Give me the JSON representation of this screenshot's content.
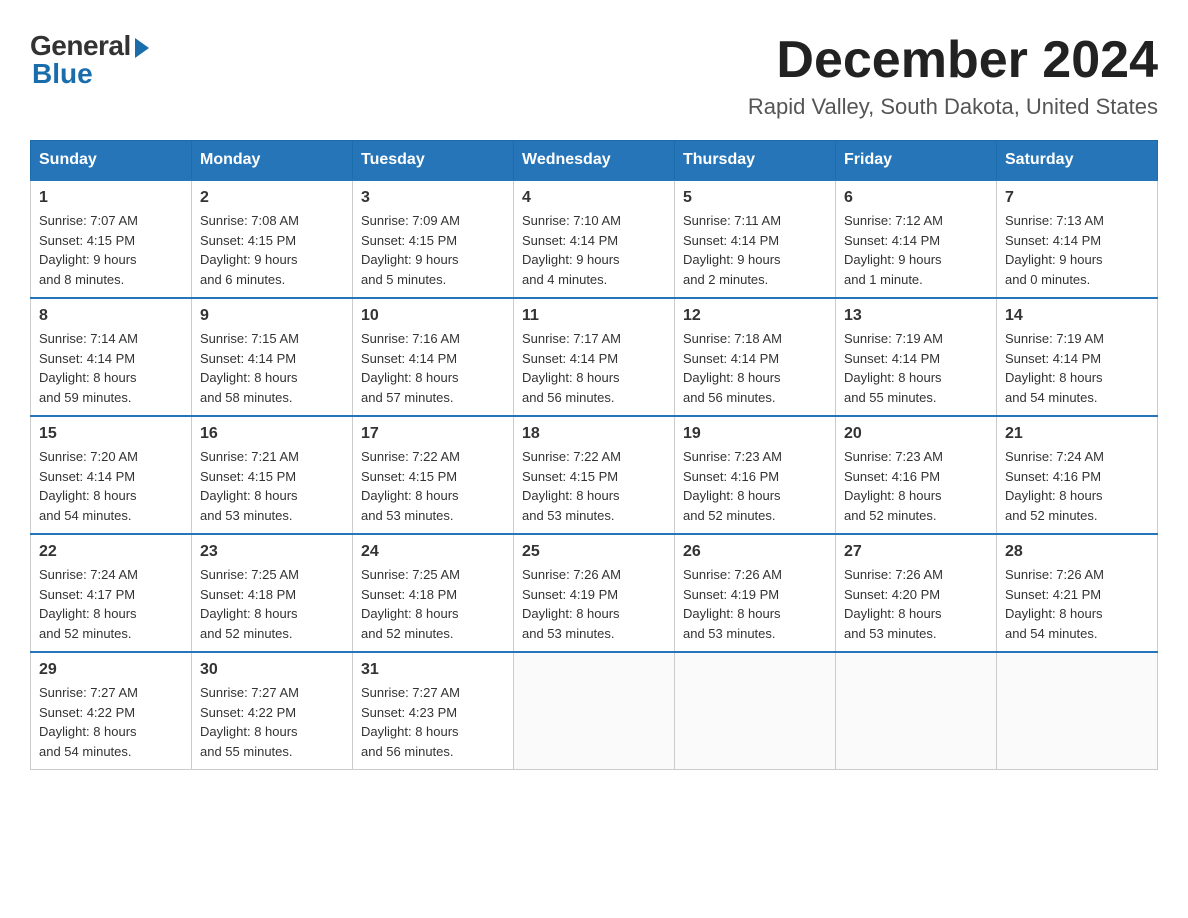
{
  "logo": {
    "general": "General",
    "blue": "Blue"
  },
  "header": {
    "month": "December 2024",
    "location": "Rapid Valley, South Dakota, United States"
  },
  "weekdays": [
    "Sunday",
    "Monday",
    "Tuesday",
    "Wednesday",
    "Thursday",
    "Friday",
    "Saturday"
  ],
  "weeks": [
    [
      {
        "day": "1",
        "sunrise": "7:07 AM",
        "sunset": "4:15 PM",
        "daylight": "9 hours and 8 minutes."
      },
      {
        "day": "2",
        "sunrise": "7:08 AM",
        "sunset": "4:15 PM",
        "daylight": "9 hours and 6 minutes."
      },
      {
        "day": "3",
        "sunrise": "7:09 AM",
        "sunset": "4:15 PM",
        "daylight": "9 hours and 5 minutes."
      },
      {
        "day": "4",
        "sunrise": "7:10 AM",
        "sunset": "4:14 PM",
        "daylight": "9 hours and 4 minutes."
      },
      {
        "day": "5",
        "sunrise": "7:11 AM",
        "sunset": "4:14 PM",
        "daylight": "9 hours and 2 minutes."
      },
      {
        "day": "6",
        "sunrise": "7:12 AM",
        "sunset": "4:14 PM",
        "daylight": "9 hours and 1 minute."
      },
      {
        "day": "7",
        "sunrise": "7:13 AM",
        "sunset": "4:14 PM",
        "daylight": "9 hours and 0 minutes."
      }
    ],
    [
      {
        "day": "8",
        "sunrise": "7:14 AM",
        "sunset": "4:14 PM",
        "daylight": "8 hours and 59 minutes."
      },
      {
        "day": "9",
        "sunrise": "7:15 AM",
        "sunset": "4:14 PM",
        "daylight": "8 hours and 58 minutes."
      },
      {
        "day": "10",
        "sunrise": "7:16 AM",
        "sunset": "4:14 PM",
        "daylight": "8 hours and 57 minutes."
      },
      {
        "day": "11",
        "sunrise": "7:17 AM",
        "sunset": "4:14 PM",
        "daylight": "8 hours and 56 minutes."
      },
      {
        "day": "12",
        "sunrise": "7:18 AM",
        "sunset": "4:14 PM",
        "daylight": "8 hours and 56 minutes."
      },
      {
        "day": "13",
        "sunrise": "7:19 AM",
        "sunset": "4:14 PM",
        "daylight": "8 hours and 55 minutes."
      },
      {
        "day": "14",
        "sunrise": "7:19 AM",
        "sunset": "4:14 PM",
        "daylight": "8 hours and 54 minutes."
      }
    ],
    [
      {
        "day": "15",
        "sunrise": "7:20 AM",
        "sunset": "4:14 PM",
        "daylight": "8 hours and 54 minutes."
      },
      {
        "day": "16",
        "sunrise": "7:21 AM",
        "sunset": "4:15 PM",
        "daylight": "8 hours and 53 minutes."
      },
      {
        "day": "17",
        "sunrise": "7:22 AM",
        "sunset": "4:15 PM",
        "daylight": "8 hours and 53 minutes."
      },
      {
        "day": "18",
        "sunrise": "7:22 AM",
        "sunset": "4:15 PM",
        "daylight": "8 hours and 53 minutes."
      },
      {
        "day": "19",
        "sunrise": "7:23 AM",
        "sunset": "4:16 PM",
        "daylight": "8 hours and 52 minutes."
      },
      {
        "day": "20",
        "sunrise": "7:23 AM",
        "sunset": "4:16 PM",
        "daylight": "8 hours and 52 minutes."
      },
      {
        "day": "21",
        "sunrise": "7:24 AM",
        "sunset": "4:16 PM",
        "daylight": "8 hours and 52 minutes."
      }
    ],
    [
      {
        "day": "22",
        "sunrise": "7:24 AM",
        "sunset": "4:17 PM",
        "daylight": "8 hours and 52 minutes."
      },
      {
        "day": "23",
        "sunrise": "7:25 AM",
        "sunset": "4:18 PM",
        "daylight": "8 hours and 52 minutes."
      },
      {
        "day": "24",
        "sunrise": "7:25 AM",
        "sunset": "4:18 PM",
        "daylight": "8 hours and 52 minutes."
      },
      {
        "day": "25",
        "sunrise": "7:26 AM",
        "sunset": "4:19 PM",
        "daylight": "8 hours and 53 minutes."
      },
      {
        "day": "26",
        "sunrise": "7:26 AM",
        "sunset": "4:19 PM",
        "daylight": "8 hours and 53 minutes."
      },
      {
        "day": "27",
        "sunrise": "7:26 AM",
        "sunset": "4:20 PM",
        "daylight": "8 hours and 53 minutes."
      },
      {
        "day": "28",
        "sunrise": "7:26 AM",
        "sunset": "4:21 PM",
        "daylight": "8 hours and 54 minutes."
      }
    ],
    [
      {
        "day": "29",
        "sunrise": "7:27 AM",
        "sunset": "4:22 PM",
        "daylight": "8 hours and 54 minutes."
      },
      {
        "day": "30",
        "sunrise": "7:27 AM",
        "sunset": "4:22 PM",
        "daylight": "8 hours and 55 minutes."
      },
      {
        "day": "31",
        "sunrise": "7:27 AM",
        "sunset": "4:23 PM",
        "daylight": "8 hours and 56 minutes."
      },
      null,
      null,
      null,
      null
    ]
  ],
  "labels": {
    "sunrise": "Sunrise:",
    "sunset": "Sunset:",
    "daylight": "Daylight:"
  }
}
